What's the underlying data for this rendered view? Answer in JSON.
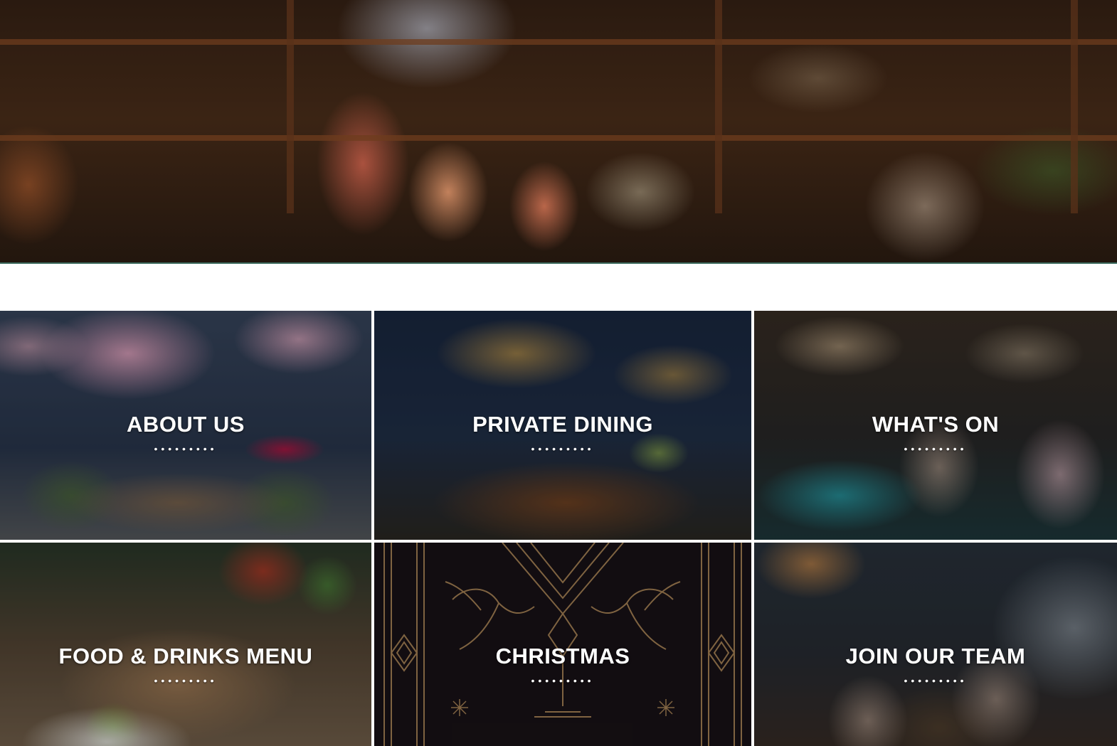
{
  "hero": {
    "alt_icon": "bartender-cocktail-photo"
  },
  "tiles": [
    {
      "label": "ABOUT US",
      "dots": "•••••••••",
      "image_icon": "garden-blossom-photo"
    },
    {
      "label": "PRIVATE DINING",
      "dots": "•••••••••",
      "image_icon": "dining-room-photo"
    },
    {
      "label": "WHAT'S ON",
      "dots": "•••••••••",
      "image_icon": "bar-people-photo"
    },
    {
      "label": "FOOD & DRINKS MENU",
      "dots": "•••••••••",
      "image_icon": "table-food-photo"
    },
    {
      "label": "CHRISTMAS",
      "dots": "•••••••••",
      "image_icon": "art-deco-hummingbird-art"
    },
    {
      "label": "JOIN OUR TEAM",
      "dots": "•••••••••",
      "image_icon": "staff-behind-bar-photo"
    }
  ],
  "colors": {
    "overlay_text": "#ffffff",
    "christmas_gold": "#b08a5a",
    "christmas_bg": "#1a1318"
  }
}
